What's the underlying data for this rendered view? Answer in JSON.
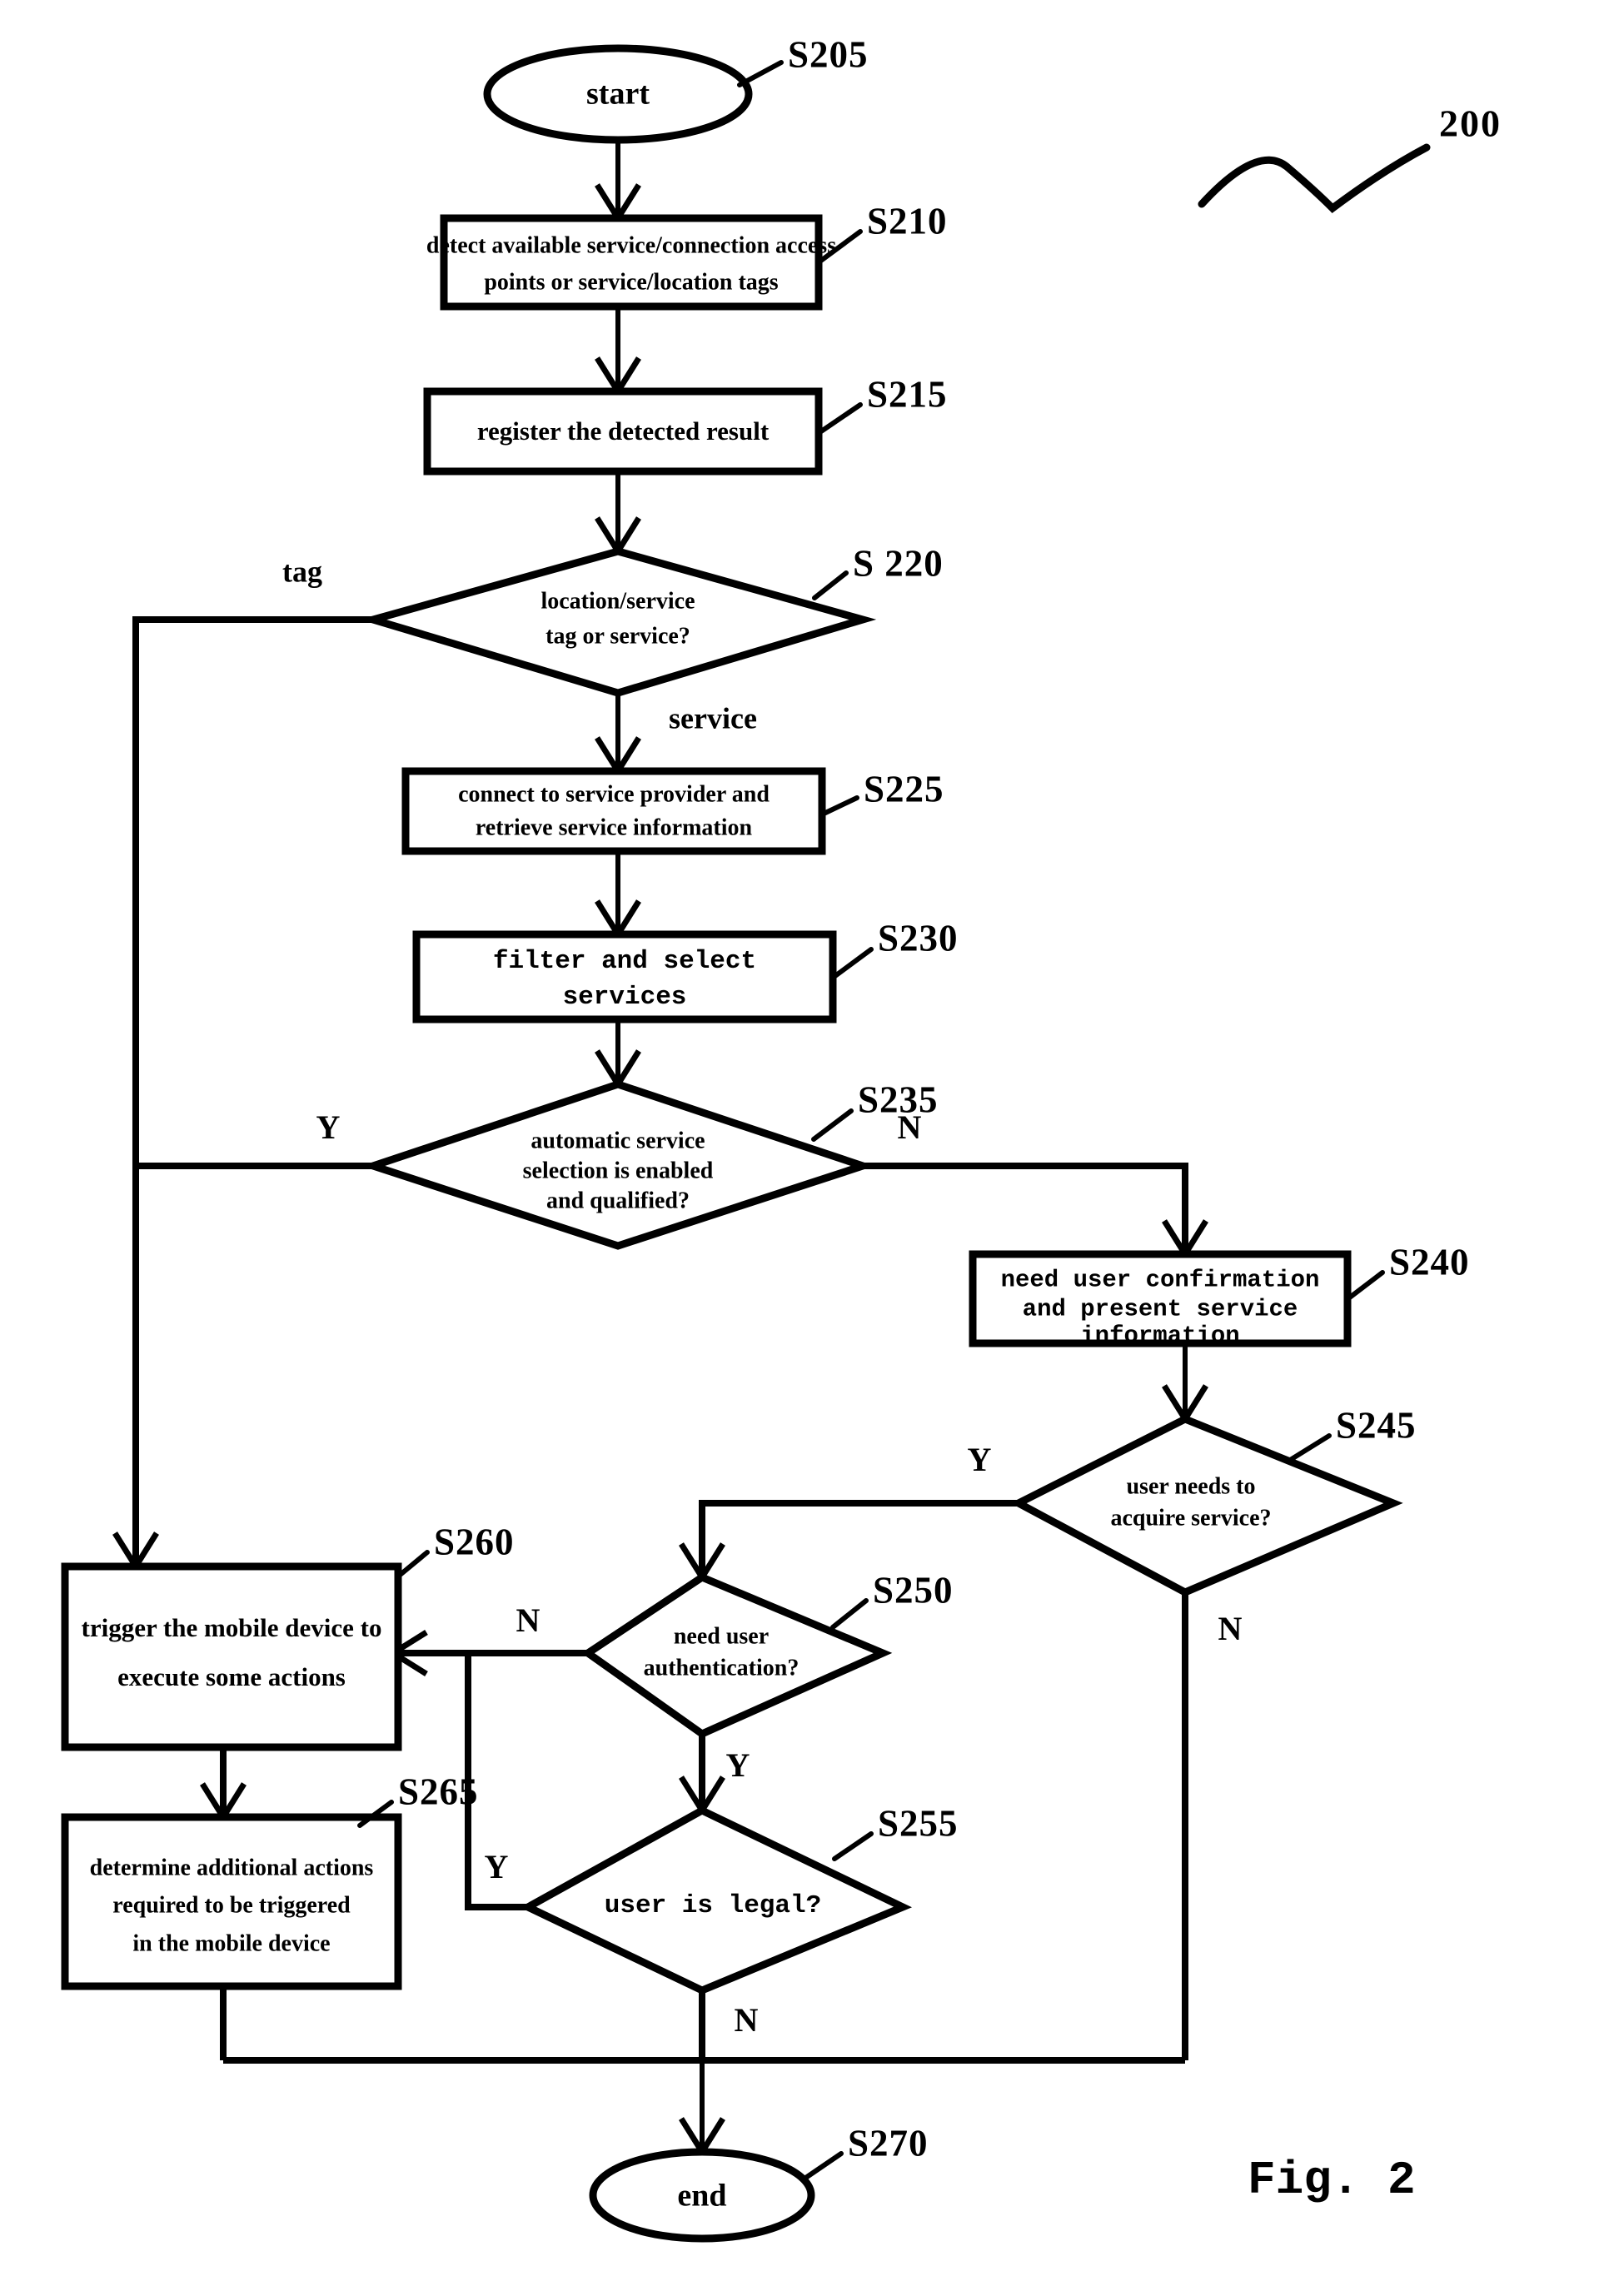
{
  "figure": {
    "caption": "Fig. 2",
    "assembly_reference": "200"
  },
  "nodes": [
    {
      "id": "S205",
      "ref": "S205",
      "type": "terminal",
      "lines": [
        "start"
      ]
    },
    {
      "id": "S210",
      "ref": "S210",
      "type": "process",
      "lines": [
        "detect available service/connection access",
        "points or service/location tags"
      ]
    },
    {
      "id": "S215",
      "ref": "S215",
      "type": "process",
      "lines": [
        "register the detected result"
      ]
    },
    {
      "id": "S220",
      "ref": "S220",
      "type": "decision",
      "lines": [
        "location/service",
        "tag or service?"
      ]
    },
    {
      "id": "S225",
      "ref": "S225",
      "type": "process",
      "lines": [
        "connect to service provider and",
        "retrieve  service information"
      ]
    },
    {
      "id": "S230",
      "ref": "S230",
      "type": "process-mono",
      "lines": [
        "filter and select",
        "services"
      ]
    },
    {
      "id": "S235",
      "ref": "S235",
      "type": "decision",
      "lines": [
        "automatic service",
        "selection is enabled",
        "and qualified?"
      ]
    },
    {
      "id": "S240",
      "ref": "S240",
      "type": "process-mono",
      "lines": [
        "need user confirmation",
        "and present service",
        "information"
      ]
    },
    {
      "id": "S245",
      "ref": "S245",
      "type": "decision",
      "lines": [
        "user needs to",
        "acquire service?"
      ]
    },
    {
      "id": "S250",
      "ref": "S250",
      "type": "decision",
      "lines": [
        "need user",
        "authentication?"
      ]
    },
    {
      "id": "S255",
      "ref": "S255",
      "type": "decision",
      "lines": [
        "user is legal?"
      ]
    },
    {
      "id": "S260",
      "ref": "S260",
      "type": "process",
      "lines": [
        "trigger the mobile device to",
        "execute some actions"
      ]
    },
    {
      "id": "S265",
      "ref": "S265",
      "type": "process",
      "lines": [
        "determine additional actions",
        "required to be triggered",
        "in the mobile device"
      ]
    },
    {
      "id": "S270",
      "ref": "S270",
      "type": "terminal",
      "lines": [
        "end"
      ]
    }
  ],
  "branch_labels": {
    "s220_tag": "tag",
    "s220_service": "service",
    "s235_yes": "Y",
    "s235_no": "N",
    "s245_yes": "Y",
    "s245_no": "N",
    "s250_no": "N",
    "s250_yes": "Y",
    "s255_yes": "Y",
    "s255_no": "N"
  },
  "refs": {
    "S205": "S205",
    "S210": "S210",
    "S215": "S215",
    "S220": "S 220",
    "S225": "S225",
    "S230": "S230",
    "S235": "S235",
    "S240": "S240",
    "S245": "S245",
    "S250": "S250",
    "S255": "S255",
    "S260": "S260",
    "S265": "S265",
    "S270": "S270"
  },
  "node_text": {
    "S205_l1": "start",
    "S210_l1": "detect available service/connection access",
    "S210_l2": "points or service/location tags",
    "S215_l1": "register the detected result",
    "S220_l1": "location/service",
    "S220_l2": "tag or service?",
    "S225_l1": "connect to service provider and",
    "S225_l2": "retrieve  service information",
    "S230_l1": "filter and select",
    "S230_l2": "services",
    "S235_l1": "automatic service",
    "S235_l2": "selection is enabled",
    "S235_l3": "and qualified?",
    "S240_l1": "need user confirmation",
    "S240_l2": "and present service",
    "S240_l3": "information",
    "S245_l1": "user needs to",
    "S245_l2": "acquire service?",
    "S250_l1": "need user",
    "S250_l2": "authentication?",
    "S255_l1": "user is legal?",
    "S260_l1": "trigger the mobile device to",
    "S260_l2": "execute some actions",
    "S265_l1": "determine additional actions",
    "S265_l2": "required to be triggered",
    "S265_l3": "in the mobile device",
    "S270_l1": "end"
  },
  "colors": {
    "ink": "#000000",
    "paper": "#ffffff"
  }
}
